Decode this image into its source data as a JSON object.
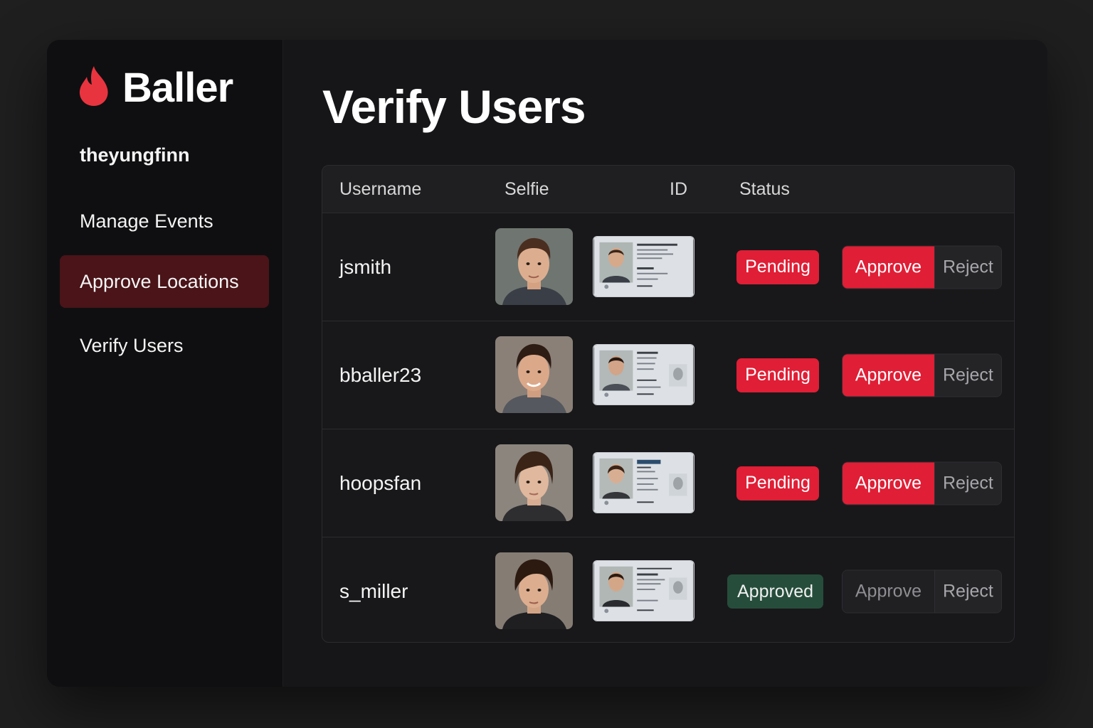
{
  "brand": {
    "name": "Baller",
    "accent": "#e01e35",
    "icon": "flame-icon"
  },
  "sidebar": {
    "username": "theyungfinn",
    "items": [
      {
        "label": "Manage Events",
        "active": false
      },
      {
        "label": "Approve Locations",
        "active": true
      },
      {
        "label": "Verify Users",
        "active": false
      }
    ]
  },
  "page": {
    "title": "Verify Users"
  },
  "table": {
    "columns": [
      "Username",
      "Selfie",
      "ID",
      "Status"
    ],
    "rows": [
      {
        "username": "jsmith",
        "status": "Pending",
        "approve_label": "Approve",
        "reject_label": "Reject"
      },
      {
        "username": "bballer23",
        "status": "Pending",
        "approve_label": "Approve",
        "reject_label": "Reject"
      },
      {
        "username": "hoopsfan",
        "status": "Pending",
        "approve_label": "Approve",
        "reject_label": "Reject"
      },
      {
        "username": "s_miller",
        "status": "Approved",
        "approve_label": "Approve",
        "reject_label": "Reject"
      }
    ]
  },
  "colors": {
    "pending": "#e01e35",
    "approved": "#264d3b",
    "active_nav": "#4a1419"
  }
}
